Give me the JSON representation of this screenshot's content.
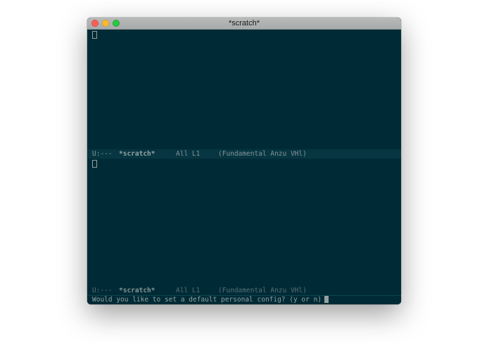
{
  "window": {
    "title": "*scratch*"
  },
  "panes": [
    {
      "modeline": {
        "status": "U:---",
        "buffer": "*scratch*",
        "position": "All L1",
        "modes": "(Fundamental Anzu VHl)"
      }
    },
    {
      "modeline": {
        "status": "U:---",
        "buffer": "*scratch*",
        "position": "All L1",
        "modes": "(Fundamental Anzu VHl)"
      }
    }
  ],
  "minibuffer": {
    "prompt": "Would you like to set a default personal config? (y or n)"
  },
  "colors": {
    "background": "#002b36",
    "modeline_active": "#073642",
    "text": "#93a1a1"
  }
}
